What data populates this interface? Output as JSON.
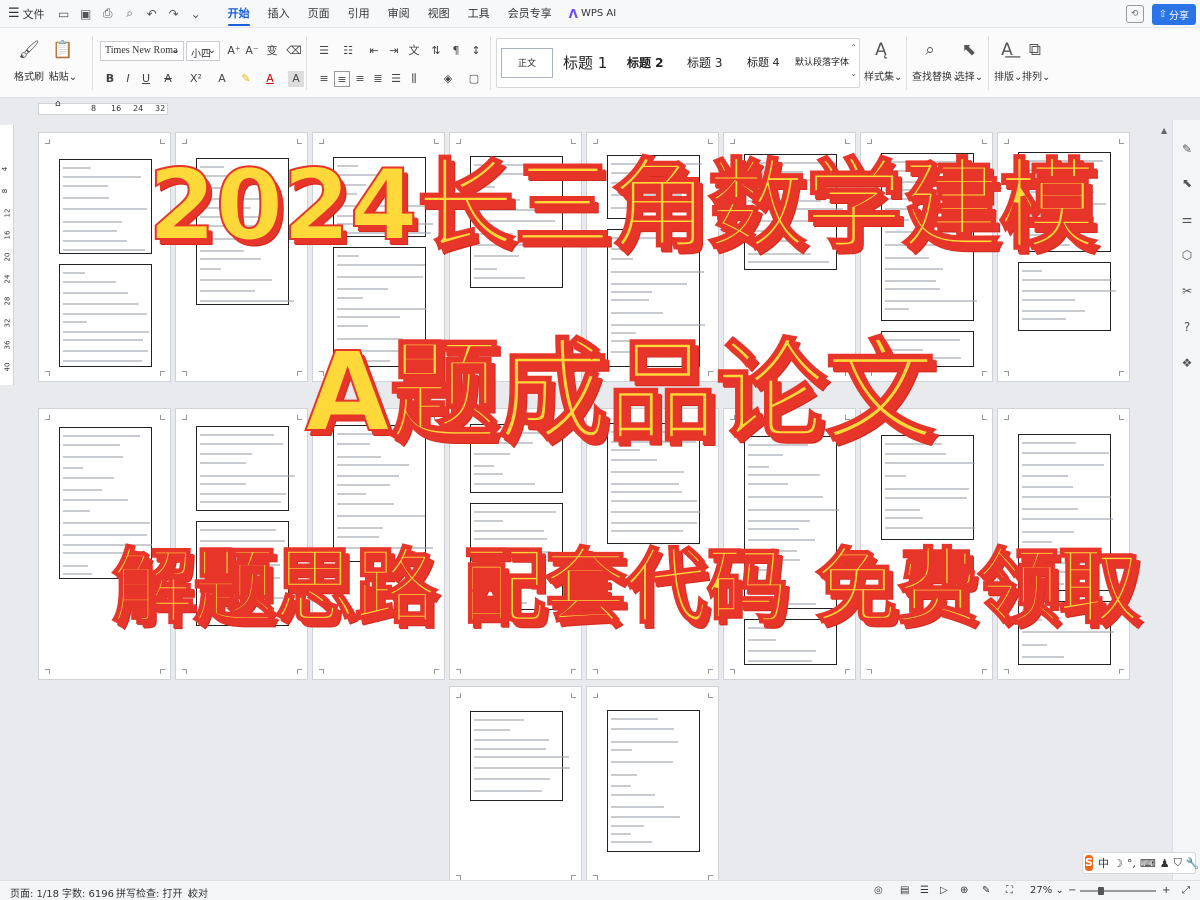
{
  "menubar": {
    "file": "文件",
    "tabs": [
      {
        "label": "开始",
        "active": true
      },
      {
        "label": "插入"
      },
      {
        "label": "页面"
      },
      {
        "label": "引用"
      },
      {
        "label": "审阅"
      },
      {
        "label": "视图"
      },
      {
        "label": "工具"
      },
      {
        "label": "会员专享"
      }
    ],
    "wps_ai": "WPS AI",
    "share": "分享"
  },
  "ribbon": {
    "format_painter": "格式刷",
    "paste": "粘贴",
    "font_name": "Times New Roma",
    "font_size": "小四",
    "styles": [
      {
        "label": "正文"
      },
      {
        "label": "标题 1"
      },
      {
        "label": "标题 2"
      },
      {
        "label": "标题 3"
      },
      {
        "label": "标题 4"
      },
      {
        "label": "默认段落字体"
      }
    ],
    "styles_set": "样式集",
    "find_replace": "查找替换",
    "select": "选择",
    "layout": "排版",
    "arrange": "排列"
  },
  "ruler": {
    "ticks": [
      "8",
      "16",
      "24",
      "32"
    ],
    "vticks": [
      "4",
      "8",
      "12",
      "16",
      "20",
      "24",
      "28",
      "32",
      "36",
      "40"
    ]
  },
  "overlay": {
    "line1": "2024长三角数学建模",
    "line2": "A题成品论文",
    "line3": "解题思路 配套代码 免费领取"
  },
  "statusbar": {
    "page": "页面: 1/18",
    "words": "字数: 6196",
    "spell": "拼写检查: 打开",
    "proof": "校对",
    "zoom": "27%",
    "zoom_level": 0.27
  },
  "ime": {
    "lang": "中"
  }
}
